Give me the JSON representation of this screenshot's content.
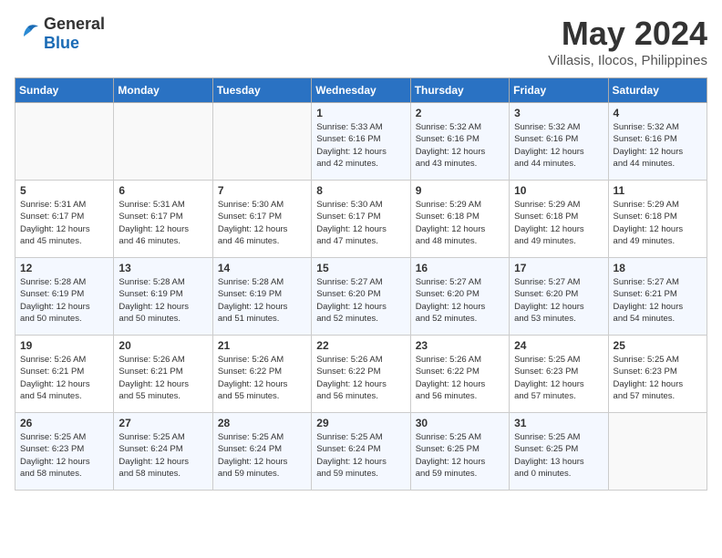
{
  "header": {
    "logo_general": "General",
    "logo_blue": "Blue",
    "month": "May 2024",
    "location": "Villasis, Ilocos, Philippines"
  },
  "days_of_week": [
    "Sunday",
    "Monday",
    "Tuesday",
    "Wednesday",
    "Thursday",
    "Friday",
    "Saturday"
  ],
  "weeks": [
    [
      {
        "day": "",
        "info": ""
      },
      {
        "day": "",
        "info": ""
      },
      {
        "day": "",
        "info": ""
      },
      {
        "day": "1",
        "info": "Sunrise: 5:33 AM\nSunset: 6:16 PM\nDaylight: 12 hours\nand 42 minutes."
      },
      {
        "day": "2",
        "info": "Sunrise: 5:32 AM\nSunset: 6:16 PM\nDaylight: 12 hours\nand 43 minutes."
      },
      {
        "day": "3",
        "info": "Sunrise: 5:32 AM\nSunset: 6:16 PM\nDaylight: 12 hours\nand 44 minutes."
      },
      {
        "day": "4",
        "info": "Sunrise: 5:32 AM\nSunset: 6:16 PM\nDaylight: 12 hours\nand 44 minutes."
      }
    ],
    [
      {
        "day": "5",
        "info": "Sunrise: 5:31 AM\nSunset: 6:17 PM\nDaylight: 12 hours\nand 45 minutes."
      },
      {
        "day": "6",
        "info": "Sunrise: 5:31 AM\nSunset: 6:17 PM\nDaylight: 12 hours\nand 46 minutes."
      },
      {
        "day": "7",
        "info": "Sunrise: 5:30 AM\nSunset: 6:17 PM\nDaylight: 12 hours\nand 46 minutes."
      },
      {
        "day": "8",
        "info": "Sunrise: 5:30 AM\nSunset: 6:17 PM\nDaylight: 12 hours\nand 47 minutes."
      },
      {
        "day": "9",
        "info": "Sunrise: 5:29 AM\nSunset: 6:18 PM\nDaylight: 12 hours\nand 48 minutes."
      },
      {
        "day": "10",
        "info": "Sunrise: 5:29 AM\nSunset: 6:18 PM\nDaylight: 12 hours\nand 49 minutes."
      },
      {
        "day": "11",
        "info": "Sunrise: 5:29 AM\nSunset: 6:18 PM\nDaylight: 12 hours\nand 49 minutes."
      }
    ],
    [
      {
        "day": "12",
        "info": "Sunrise: 5:28 AM\nSunset: 6:19 PM\nDaylight: 12 hours\nand 50 minutes."
      },
      {
        "day": "13",
        "info": "Sunrise: 5:28 AM\nSunset: 6:19 PM\nDaylight: 12 hours\nand 50 minutes."
      },
      {
        "day": "14",
        "info": "Sunrise: 5:28 AM\nSunset: 6:19 PM\nDaylight: 12 hours\nand 51 minutes."
      },
      {
        "day": "15",
        "info": "Sunrise: 5:27 AM\nSunset: 6:20 PM\nDaylight: 12 hours\nand 52 minutes."
      },
      {
        "day": "16",
        "info": "Sunrise: 5:27 AM\nSunset: 6:20 PM\nDaylight: 12 hours\nand 52 minutes."
      },
      {
        "day": "17",
        "info": "Sunrise: 5:27 AM\nSunset: 6:20 PM\nDaylight: 12 hours\nand 53 minutes."
      },
      {
        "day": "18",
        "info": "Sunrise: 5:27 AM\nSunset: 6:21 PM\nDaylight: 12 hours\nand 54 minutes."
      }
    ],
    [
      {
        "day": "19",
        "info": "Sunrise: 5:26 AM\nSunset: 6:21 PM\nDaylight: 12 hours\nand 54 minutes."
      },
      {
        "day": "20",
        "info": "Sunrise: 5:26 AM\nSunset: 6:21 PM\nDaylight: 12 hours\nand 55 minutes."
      },
      {
        "day": "21",
        "info": "Sunrise: 5:26 AM\nSunset: 6:22 PM\nDaylight: 12 hours\nand 55 minutes."
      },
      {
        "day": "22",
        "info": "Sunrise: 5:26 AM\nSunset: 6:22 PM\nDaylight: 12 hours\nand 56 minutes."
      },
      {
        "day": "23",
        "info": "Sunrise: 5:26 AM\nSunset: 6:22 PM\nDaylight: 12 hours\nand 56 minutes."
      },
      {
        "day": "24",
        "info": "Sunrise: 5:25 AM\nSunset: 6:23 PM\nDaylight: 12 hours\nand 57 minutes."
      },
      {
        "day": "25",
        "info": "Sunrise: 5:25 AM\nSunset: 6:23 PM\nDaylight: 12 hours\nand 57 minutes."
      }
    ],
    [
      {
        "day": "26",
        "info": "Sunrise: 5:25 AM\nSunset: 6:23 PM\nDaylight: 12 hours\nand 58 minutes."
      },
      {
        "day": "27",
        "info": "Sunrise: 5:25 AM\nSunset: 6:24 PM\nDaylight: 12 hours\nand 58 minutes."
      },
      {
        "day": "28",
        "info": "Sunrise: 5:25 AM\nSunset: 6:24 PM\nDaylight: 12 hours\nand 59 minutes."
      },
      {
        "day": "29",
        "info": "Sunrise: 5:25 AM\nSunset: 6:24 PM\nDaylight: 12 hours\nand 59 minutes."
      },
      {
        "day": "30",
        "info": "Sunrise: 5:25 AM\nSunset: 6:25 PM\nDaylight: 12 hours\nand 59 minutes."
      },
      {
        "day": "31",
        "info": "Sunrise: 5:25 AM\nSunset: 6:25 PM\nDaylight: 13 hours\nand 0 minutes."
      },
      {
        "day": "",
        "info": ""
      }
    ]
  ]
}
